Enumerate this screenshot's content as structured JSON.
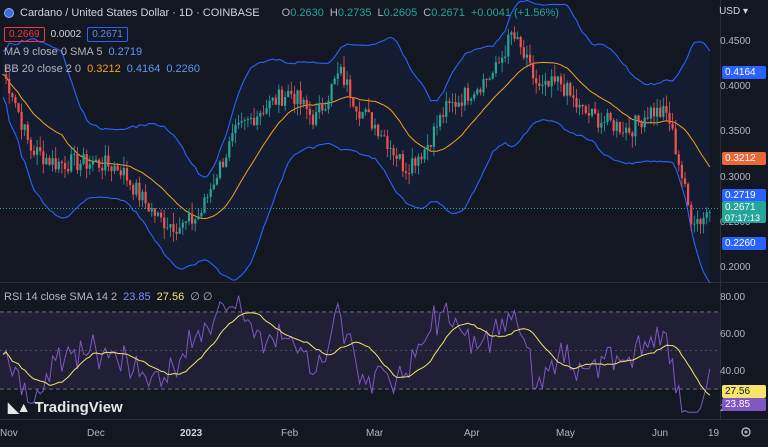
{
  "header": {
    "title": "Cardano / United States Dollar · 1D · COINBASE",
    "ohlc": [
      {
        "label": "O",
        "value": "0.2630"
      },
      {
        "label": "H",
        "value": "0.2735"
      },
      {
        "label": "L",
        "value": "0.2605"
      },
      {
        "label": "C",
        "value": "0.2671"
      },
      {
        "label": "",
        "value": "+0.0041 (+1.56%)"
      }
    ],
    "bid": "0.2669",
    "spread": "0.0002",
    "ask": "0.2671",
    "currency": "USD"
  },
  "indicators": {
    "ma": {
      "name": "MA 9 close 0 SMA 5",
      "value": "0.2719"
    },
    "bb": {
      "name": "BB 20 close 2 0",
      "basis": "0.3212",
      "upper": "0.4164",
      "lower": "0.2260"
    },
    "rsi": {
      "name": "RSI 14 close SMA 14 2",
      "value": "23.85",
      "sma": "27.56",
      "extra": "∅ ∅"
    }
  },
  "price_axis": {
    "ticks": [
      "0.4500",
      "0.4000",
      "0.3500",
      "0.3000",
      "0.2500",
      "0.2000"
    ],
    "tags": {
      "upper": "0.4164",
      "basis": "0.3212",
      "ma": "0.2719",
      "last": "0.2671",
      "countdown": "07:17:13",
      "lower": "0.2260"
    }
  },
  "rsi_axis": {
    "ticks": [
      "80.00",
      "60.00",
      "40.00",
      "20.00"
    ],
    "tags": {
      "sma": "27.56",
      "rsi": "23.85"
    }
  },
  "time_axis": [
    "Nov",
    "Dec",
    "2023",
    "Feb",
    "Mar",
    "Apr",
    "May",
    "Jun",
    "19"
  ],
  "watermark": "TradingView",
  "colors": {
    "up": "#26a69a",
    "down": "#ef5350",
    "bb_band": "#2962ff",
    "basis": "#f7a21b",
    "rsi_line": "#7e57c2",
    "rsi_sma": "#f5e56b"
  },
  "chart_data": {
    "type": "candlestick",
    "series": [
      {
        "name": "Cardano / United States Dollar",
        "unit": "USD",
        "close_by_month": {
          "Nov": 0.33,
          "Dec": 0.31,
          "2023": 0.26,
          "Feb": 0.38,
          "Mar": 0.33,
          "Apr": 0.44,
          "May": 0.38,
          "Jun": 0.33
        },
        "last": {
          "open": 0.263,
          "high": 0.2735,
          "low": 0.2605,
          "close": 0.2671
        }
      }
    ],
    "y_range": [
      0.19,
      0.47
    ],
    "rsi_range": [
      15,
      85
    ]
  }
}
